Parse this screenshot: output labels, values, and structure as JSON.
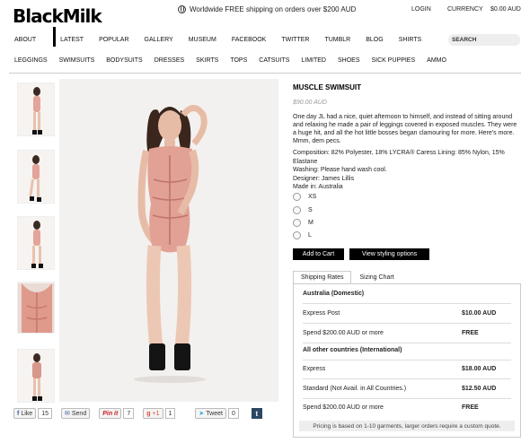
{
  "header": {
    "logo": "BlackMilk",
    "shipping_text": "Worldwide FREE shipping on orders over $200 AUD",
    "login": "LOGIN",
    "currency": "CURRENCY",
    "cart": "$0.00 AUD",
    "search_label": "SEARCH"
  },
  "nav_main": [
    "ABOUT",
    "LATEST",
    "POPULAR",
    "GALLERY",
    "MUSEUM",
    "FACEBOOK",
    "TWITTER",
    "TUMBLR",
    "BLOG",
    "SHIRTS"
  ],
  "nav_categories": [
    "LEGGINGS",
    "SWIMSUITS",
    "BODYSUITS",
    "DRESSES",
    "SKIRTS",
    "TOPS",
    "CATSUITS",
    "LIMITED",
    "SHOES",
    "SICK PUPPIES",
    "AMMO"
  ],
  "social": {
    "like_label": "Like",
    "like_count": "15",
    "send_label": "Send",
    "pin_label": "Pin it",
    "pin_count": "7",
    "gplus_label": "+1",
    "gplus_count": "1",
    "tweet_label": "Tweet",
    "tweet_count": "0",
    "tumblr_label": "t"
  },
  "product": {
    "title": "MUSCLE SWIMSUIT",
    "price": "$90.00 AUD",
    "description": "One day JL had a nice, quiet afternoon to himself, and instead of sitting around and relaxing he made a pair of leggings covered in exposed muscles. They were a huge hit, and all the hot little bosses began clamouring for more. Here's more. Mmm, dem pecs.",
    "composition": "Composition: 82% Polyester, 18% LYCRA® Caress Lining: 85% Nylon, 15% Elastane",
    "washing": "Washing: Please hand wash cool.",
    "designer": "Designer: James Lillis",
    "made_in": "Made in: Australia",
    "sizes": [
      "XS",
      "S",
      "M",
      "L"
    ],
    "add_to_cart": "Add to Cart",
    "styling": "View styling options"
  },
  "shipping": {
    "tabs": [
      "Shipping Rates",
      "Sizing Chart"
    ],
    "rows": [
      {
        "label": "Australia (Domestic)",
        "value": "",
        "head": true
      },
      {
        "label": "Express Post",
        "value": "$10.00 AUD"
      },
      {
        "label": "Spend $200.00 AUD or more",
        "value": "FREE"
      },
      {
        "label": "All other countries (International)",
        "value": "",
        "head": true
      },
      {
        "label": "Express",
        "value": "$18.00 AUD"
      },
      {
        "label": "Standard (Not Avail. in All Countries.)",
        "value": "$12.50 AUD"
      },
      {
        "label": "Spend $200.00 AUD or more",
        "value": "FREE"
      }
    ],
    "note": "Pricing is based on 1-10 garments, larger orders require a custom quote."
  }
}
